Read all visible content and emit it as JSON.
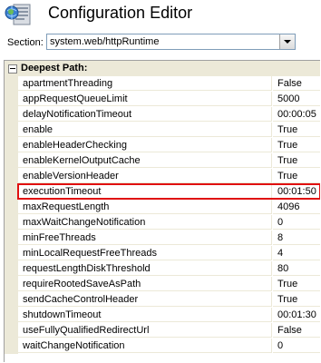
{
  "header": {
    "title": "Configuration Editor",
    "icon": "configuration-editor-icon"
  },
  "section": {
    "label": "Section:",
    "value": "system.web/httpRuntime"
  },
  "grid": {
    "category": "Deepest Path:",
    "properties": [
      {
        "name": "apartmentThreading",
        "value": "False"
      },
      {
        "name": "appRequestQueueLimit",
        "value": "5000"
      },
      {
        "name": "delayNotificationTimeout",
        "value": "00:00:05"
      },
      {
        "name": "enable",
        "value": "True"
      },
      {
        "name": "enableHeaderChecking",
        "value": "True"
      },
      {
        "name": "enableKernelOutputCache",
        "value": "True"
      },
      {
        "name": "enableVersionHeader",
        "value": "True"
      },
      {
        "name": "executionTimeout",
        "value": "00:01:50",
        "highlighted": true
      },
      {
        "name": "maxRequestLength",
        "value": "4096"
      },
      {
        "name": "maxWaitChangeNotification",
        "value": "0"
      },
      {
        "name": "minFreeThreads",
        "value": "8"
      },
      {
        "name": "minLocalRequestFreeThreads",
        "value": "4"
      },
      {
        "name": "requestLengthDiskThreshold",
        "value": "80"
      },
      {
        "name": "requireRootedSaveAsPath",
        "value": "True"
      },
      {
        "name": "sendCacheControlHeader",
        "value": "True"
      },
      {
        "name": "shutdownTimeout",
        "value": "00:01:30"
      },
      {
        "name": "useFullyQualifiedRedirectUrl",
        "value": "False"
      },
      {
        "name": "waitChangeNotification",
        "value": "0"
      }
    ]
  },
  "colors": {
    "highlight_border": "#e01010",
    "grid_line": "#ece9d8"
  }
}
